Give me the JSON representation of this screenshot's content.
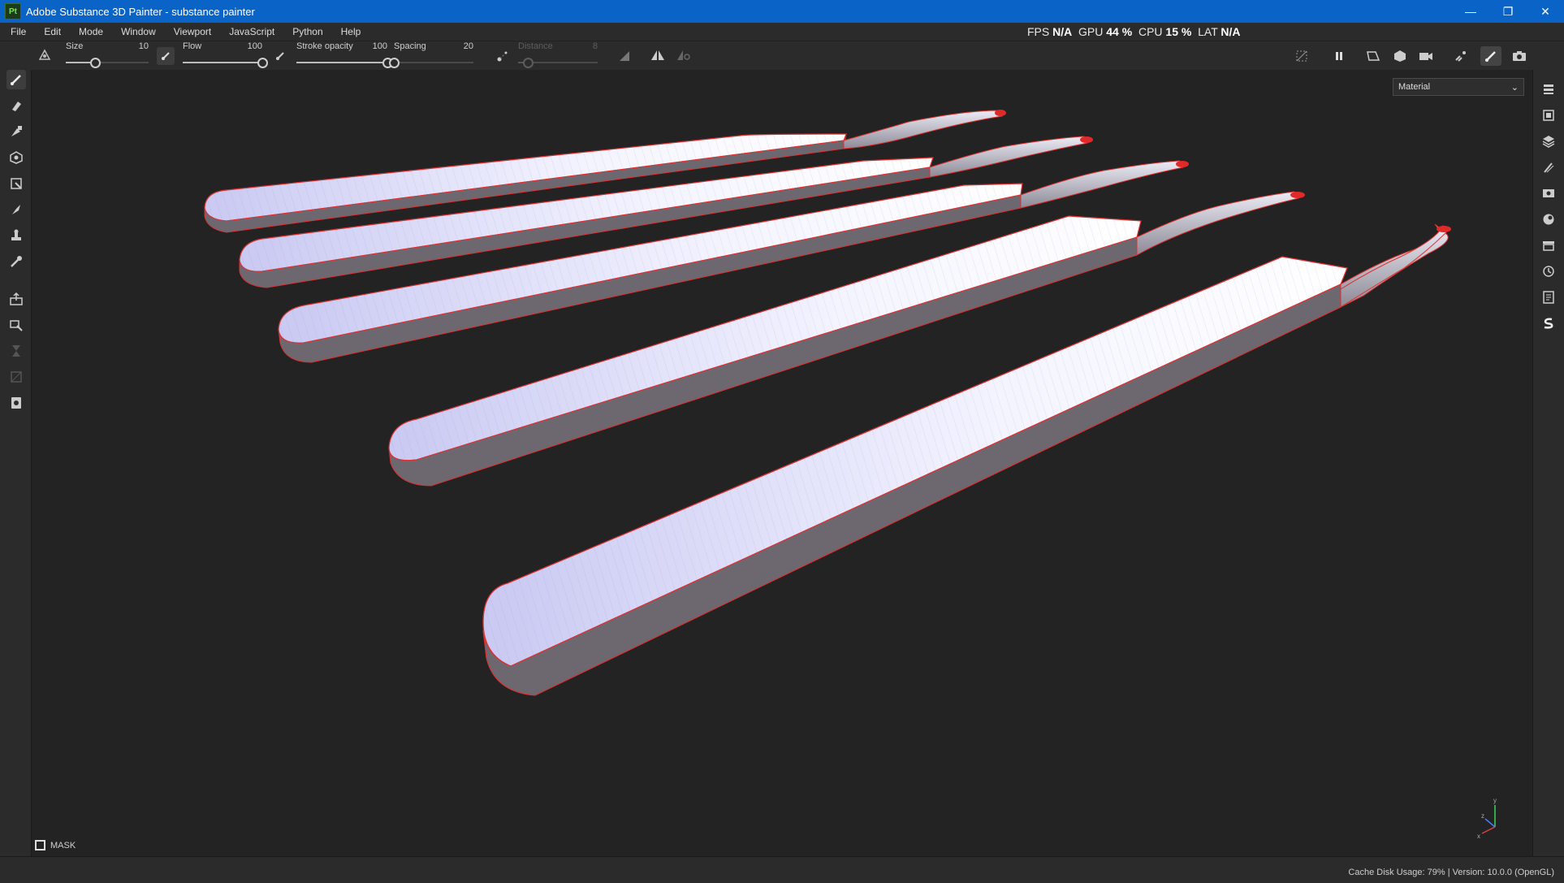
{
  "window": {
    "app_badge": "Pt",
    "title": "Adobe Substance 3D Painter - substance painter",
    "minimize_glyph": "—",
    "restore_glyph": "❐",
    "close_glyph": "✕"
  },
  "menu": [
    "File",
    "Edit",
    "Mode",
    "Window",
    "Viewport",
    "JavaScript",
    "Python",
    "Help"
  ],
  "perf": {
    "fps_label": "FPS",
    "fps_value": "N/A",
    "gpu_label": "GPU",
    "gpu_value": "44 %",
    "cpu_label": "CPU",
    "cpu_value": "15 %",
    "lat_label": "LAT",
    "lat_value": "N/A"
  },
  "tool_properties": {
    "size": {
      "label": "Size",
      "value": "10",
      "fraction": 0.35
    },
    "flow": {
      "label": "Flow",
      "value": "100",
      "fraction": 1.0
    },
    "stroke_opacity": {
      "label": "Stroke opacity",
      "value": "100",
      "fraction": 1.0
    },
    "spacing": {
      "label": "Spacing",
      "value": "20",
      "fraction": 0.0
    },
    "distance": {
      "label": "Distance",
      "value": "8",
      "fraction": 0.12,
      "disabled": true
    }
  },
  "left_tools": [
    "paint-brush-icon",
    "eraser-icon",
    "projection-icon",
    "geometry-fill-icon",
    "polygon-fill-icon",
    "smudge-icon",
    "clone-icon",
    "color-picker-icon",
    "bake-export-icon",
    "material-picker-icon",
    "hourglass-icon",
    "disabled-tool-icon",
    "iray-render-icon"
  ],
  "right_tools": [
    "layers-panel-icon",
    "texture-set-icon",
    "layer-stack-icon",
    "properties-icon",
    "display-settings-icon",
    "shader-settings-icon",
    "shelf-icon",
    "history-icon",
    "log-icon",
    "substance-source-icon"
  ],
  "viewport": {
    "channel": "Material",
    "mask_label": "MASK",
    "axis": {
      "x": "x",
      "y": "y",
      "z": "z"
    }
  },
  "status": {
    "cache_label": "Cache Disk Usage:",
    "cache_value": "79%",
    "separator": "|",
    "version": "Version: 10.0.0 (OpenGL)"
  }
}
